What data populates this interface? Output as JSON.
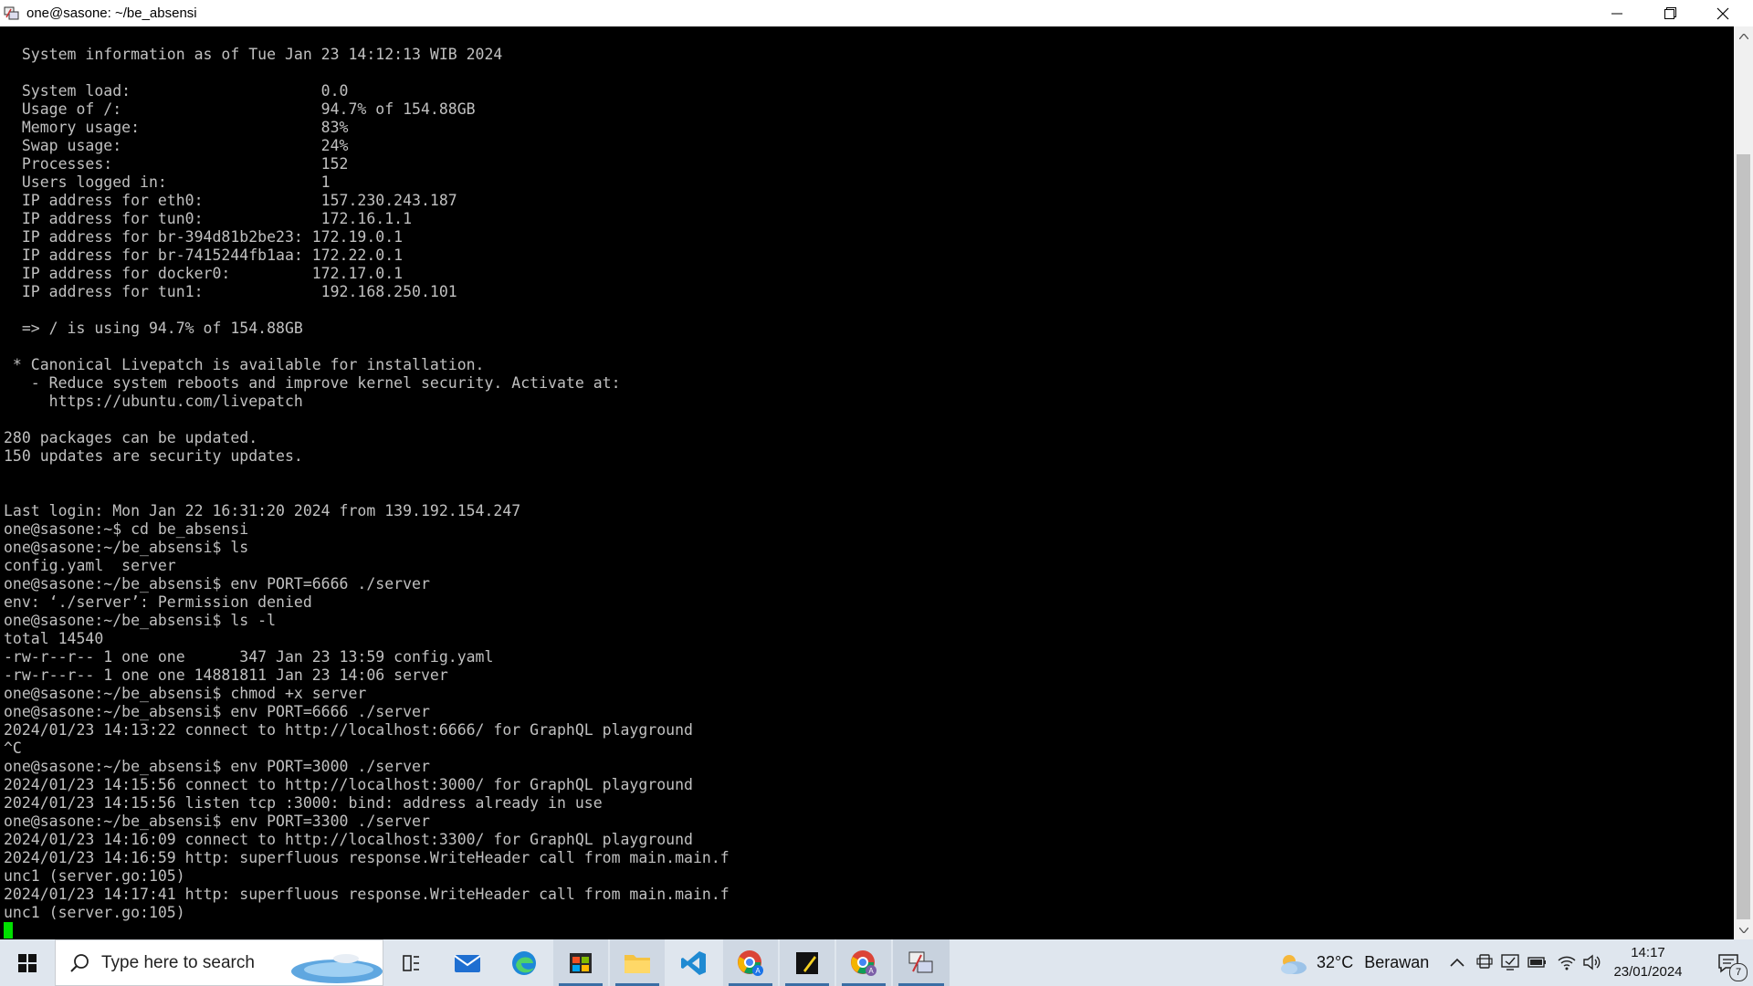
{
  "window": {
    "title": "one@sasone: ~/be_absensi"
  },
  "terminal": {
    "lines": [
      "  System information as of Tue Jan 23 14:12:13 WIB 2024",
      "",
      "  System load:                     0.0",
      "  Usage of /:                      94.7% of 154.88GB",
      "  Memory usage:                    83%",
      "  Swap usage:                      24%",
      "  Processes:                       152",
      "  Users logged in:                 1",
      "  IP address for eth0:             157.230.243.187",
      "  IP address for tun0:             172.16.1.1",
      "  IP address for br-394d81b2be23: 172.19.0.1",
      "  IP address for br-7415244fb1aa: 172.22.0.1",
      "  IP address for docker0:         172.17.0.1",
      "  IP address for tun1:             192.168.250.101",
      "",
      "  => / is using 94.7% of 154.88GB",
      "",
      " * Canonical Livepatch is available for installation.",
      "   - Reduce system reboots and improve kernel security. Activate at:",
      "     https://ubuntu.com/livepatch",
      "",
      "280 packages can be updated.",
      "150 updates are security updates.",
      "",
      "",
      "Last login: Mon Jan 22 16:31:20 2024 from 139.192.154.247",
      "one@sasone:~$ cd be_absensi",
      "one@sasone:~/be_absensi$ ls",
      "config.yaml  server",
      "one@sasone:~/be_absensi$ env PORT=6666 ./server",
      "env: ‘./server’: Permission denied",
      "one@sasone:~/be_absensi$ ls -l",
      "total 14540",
      "-rw-r--r-- 1 one one      347 Jan 23 13:59 config.yaml",
      "-rw-r--r-- 1 one one 14881811 Jan 23 14:06 server",
      "one@sasone:~/be_absensi$ chmod +x server",
      "one@sasone:~/be_absensi$ env PORT=6666 ./server",
      "2024/01/23 14:13:22 connect to http://localhost:6666/ for GraphQL playground",
      "^C",
      "one@sasone:~/be_absensi$ env PORT=3000 ./server",
      "2024/01/23 14:15:56 connect to http://localhost:3000/ for GraphQL playground",
      "2024/01/23 14:15:56 listen tcp :3000: bind: address already in use",
      "one@sasone:~/be_absensi$ env PORT=3300 ./server",
      "2024/01/23 14:16:09 connect to http://localhost:3300/ for GraphQL playground",
      "2024/01/23 14:16:59 http: superfluous response.WriteHeader call from main.main.f",
      "unc1 (server.go:105)",
      "2024/01/23 14:17:41 http: superfluous response.WriteHeader call from main.main.f",
      "unc1 (server.go:105)"
    ],
    "cursor_color": "#00e000",
    "text_color": "#c0c0c0",
    "background": "#000000"
  },
  "taskbar": {
    "search_placeholder": "Type here to search",
    "apps": [
      {
        "icon": "task-view-icon",
        "active": false
      },
      {
        "icon": "mail-icon",
        "active": false
      },
      {
        "icon": "edge-icon",
        "active": false
      },
      {
        "icon": "store-icon",
        "active": true
      },
      {
        "icon": "file-explorer-icon",
        "active": true
      },
      {
        "icon": "vscode-icon",
        "active": false
      },
      {
        "icon": "chrome-profile-icon",
        "active": true
      },
      {
        "icon": "sticky-notes-icon",
        "active": true
      },
      {
        "icon": "chrome-icon",
        "active": true
      },
      {
        "icon": "putty-icon",
        "active": true
      }
    ],
    "weather": {
      "temp": "32°C",
      "condition": "Berawan"
    },
    "clock": {
      "time": "14:17",
      "date": "23/01/2024"
    },
    "notification_count": "7"
  }
}
